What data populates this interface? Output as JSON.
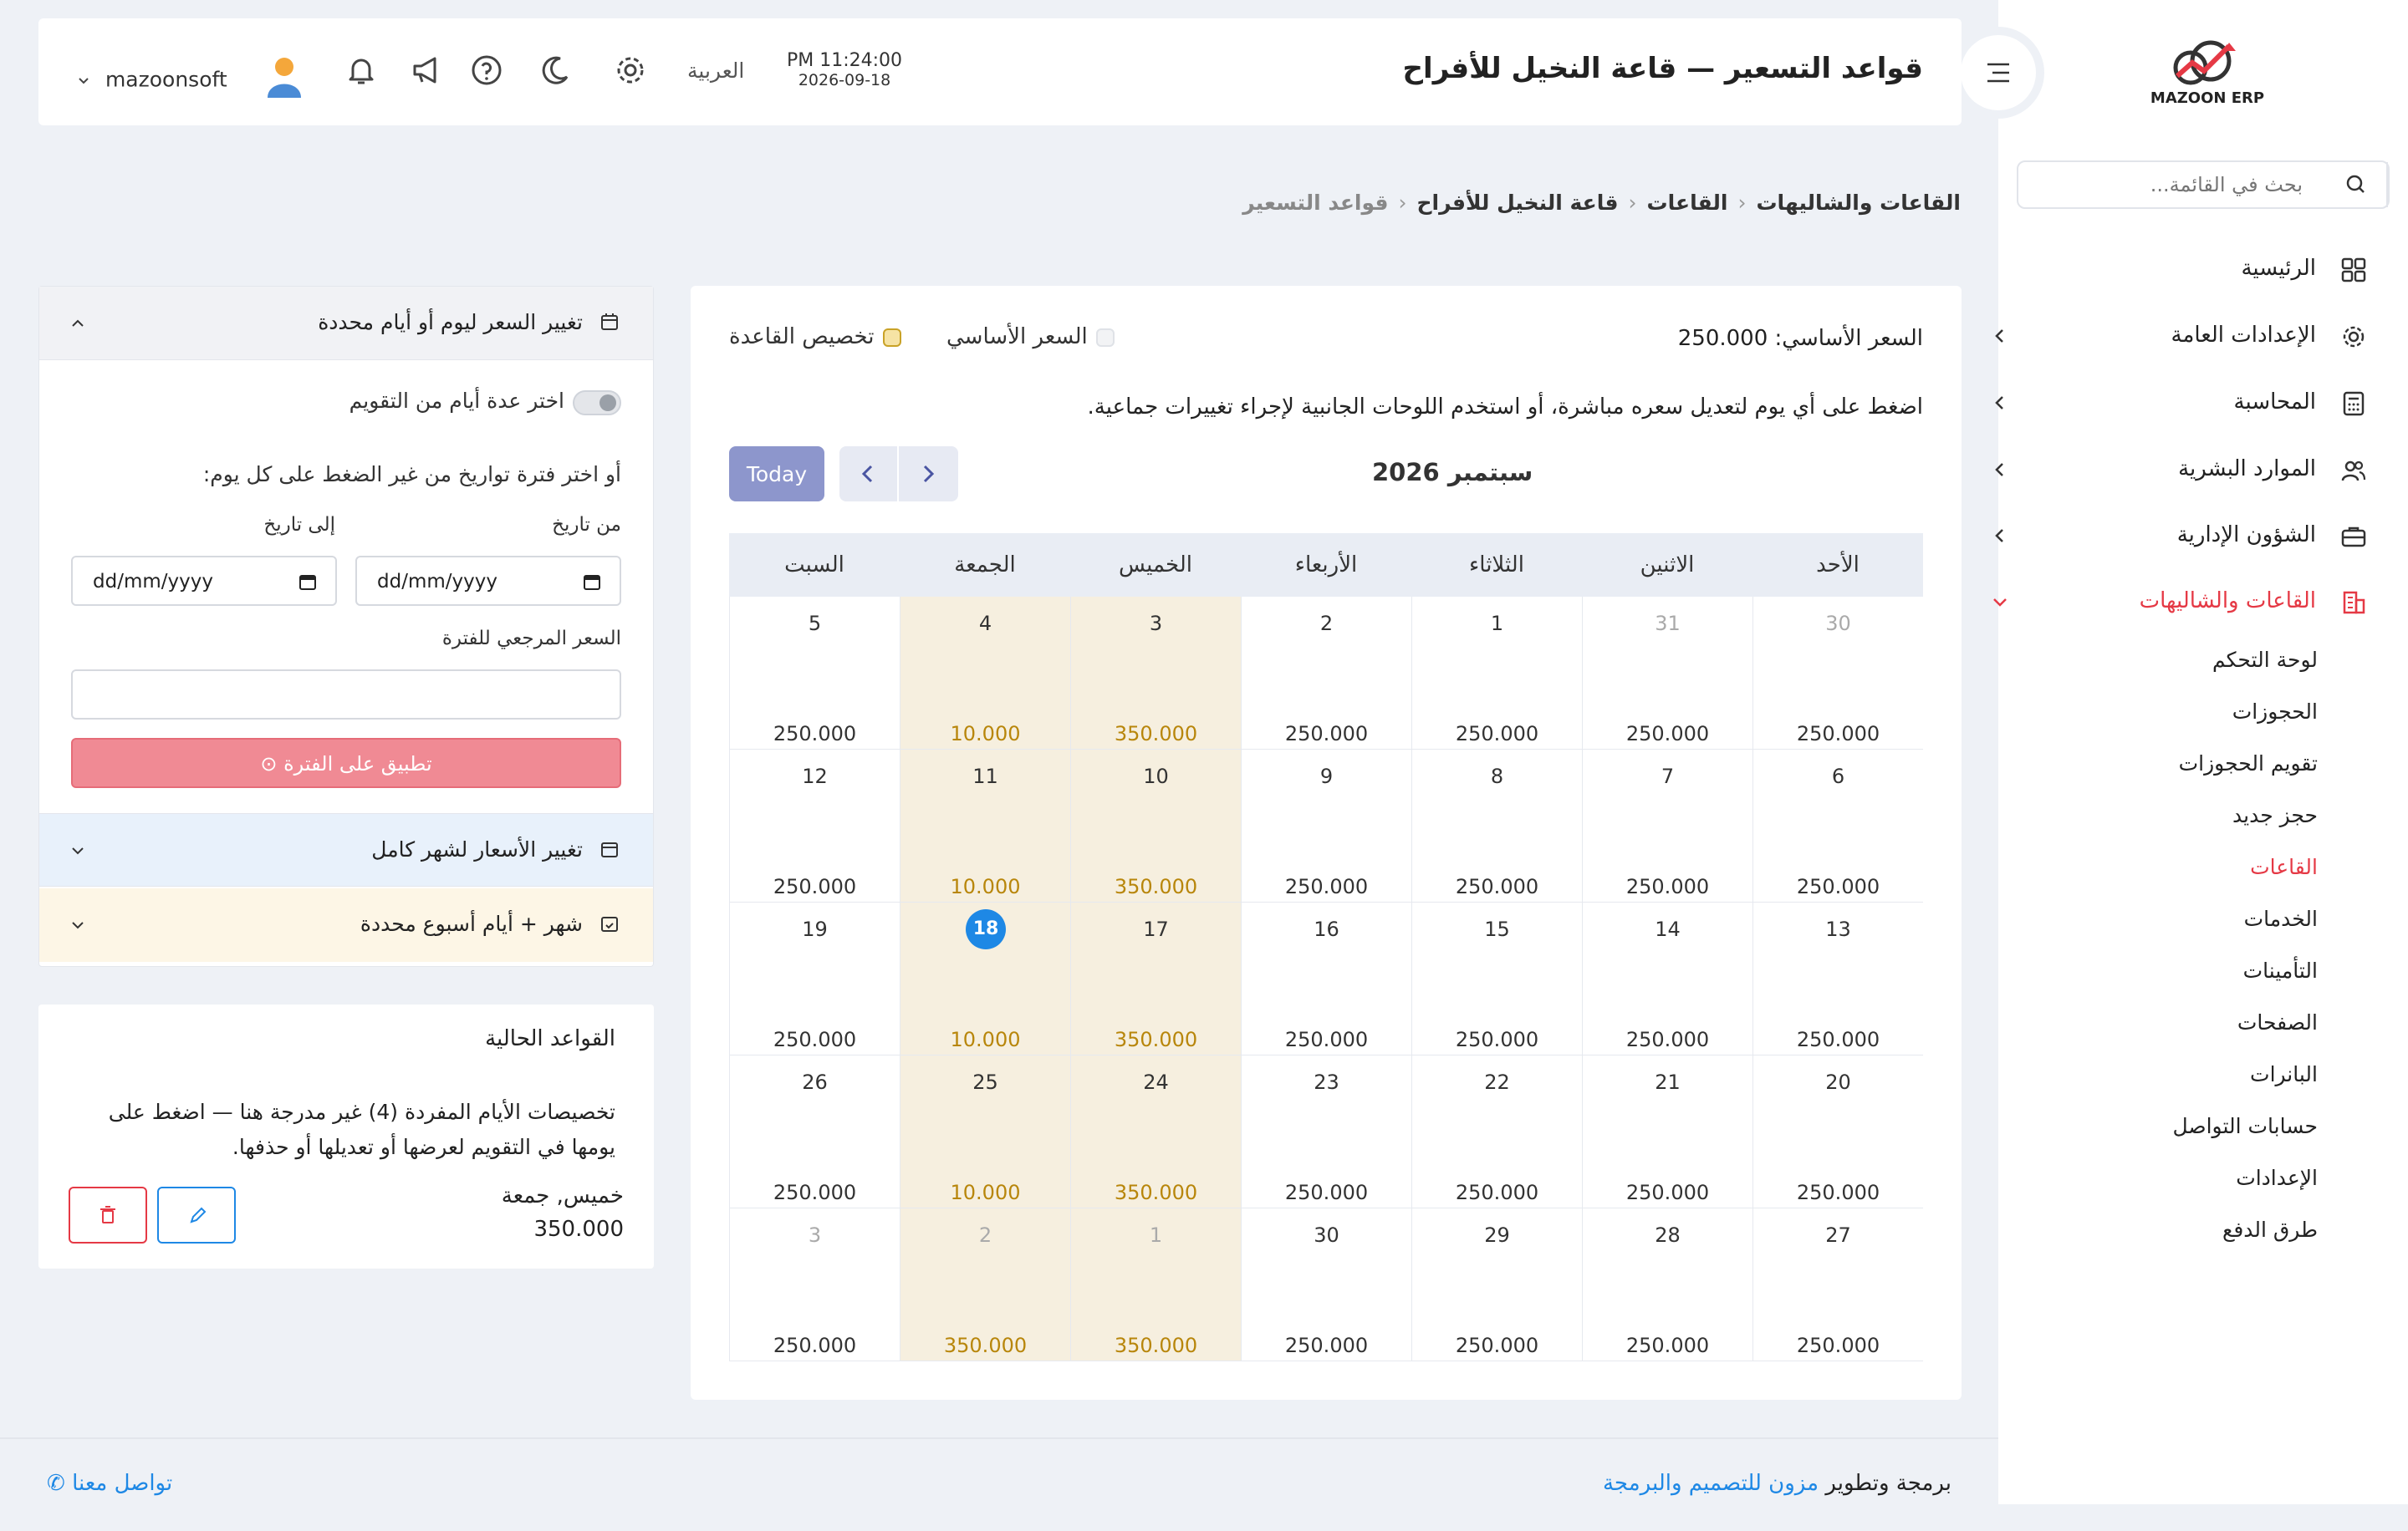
{
  "header": {
    "title": "قواعد التسعير — قاعة النخيل للأفراح",
    "time": "PM 11:24:00",
    "date": "2026-09-18",
    "language": "العربية",
    "username": "mazoonsoft"
  },
  "sidebar": {
    "logo_text": "MAZOON ERP",
    "search_placeholder": "بحث في القائمة...",
    "items": [
      {
        "label": "الرئيسية",
        "icon": "grid-icon"
      },
      {
        "label": "الإعدادات العامة",
        "icon": "gear-icon"
      },
      {
        "label": "المحاسبة",
        "icon": "calculator-icon"
      },
      {
        "label": "الموارد البشرية",
        "icon": "users-icon"
      },
      {
        "label": "الشؤون الإدارية",
        "icon": "briefcase-icon"
      },
      {
        "label": "القاعات والشاليهات",
        "icon": "building-icon"
      }
    ],
    "subitems": [
      "لوحة التحكم",
      "الحجوزات",
      "تقويم الحجوزات",
      "حجز جديد",
      "القاعات",
      "الخدمات",
      "التأمينات",
      "الصفحات",
      "البانرات",
      "حسابات التواصل",
      "الإعدادات",
      "طرق الدفع"
    ],
    "active_color": "#e53945"
  },
  "breadcrumb": [
    "القاعات والشاليهات",
    "القاعات",
    "قاعة النخيل للأفراح",
    "قواعد التسعير"
  ],
  "main": {
    "base_price_text": "السعر الأساسي: 250.000",
    "legend_base": "السعر الأساسي",
    "legend_custom": "تخصيص القاعدة",
    "hint": "اضغط على أي يوم لتعديل سعره مباشرة، أو استخدم اللوحات الجانبية لإجراء تغييرات جماعية.",
    "month_title": "سبتمبر 2026",
    "today_label": "Today"
  },
  "calendar": {
    "weekdays": [
      "الأحد",
      "الاثنين",
      "الثلاثاء",
      "الأربعاء",
      "الخميس",
      "الجمعة",
      "السبت"
    ],
    "highlight_color": "#f6efdf",
    "weeks": [
      [
        {
          "d": "30",
          "p": "250.000",
          "m": true
        },
        {
          "d": "31",
          "p": "250.000",
          "m": true
        },
        {
          "d": "1",
          "p": "250.000"
        },
        {
          "d": "2",
          "p": "250.000"
        },
        {
          "d": "3",
          "p": "350.000",
          "g": true
        },
        {
          "d": "4",
          "p": "10.000",
          "g": true
        },
        {
          "d": "5",
          "p": "250.000"
        }
      ],
      [
        {
          "d": "6",
          "p": "250.000"
        },
        {
          "d": "7",
          "p": "250.000"
        },
        {
          "d": "8",
          "p": "250.000"
        },
        {
          "d": "9",
          "p": "250.000"
        },
        {
          "d": "10",
          "p": "350.000",
          "g": true
        },
        {
          "d": "11",
          "p": "10.000",
          "g": true
        },
        {
          "d": "12",
          "p": "250.000"
        }
      ],
      [
        {
          "d": "13",
          "p": "250.000"
        },
        {
          "d": "14",
          "p": "250.000"
        },
        {
          "d": "15",
          "p": "250.000"
        },
        {
          "d": "16",
          "p": "250.000"
        },
        {
          "d": "17",
          "p": "350.000",
          "g": true
        },
        {
          "d": "18",
          "p": "10.000",
          "g": true,
          "t": true
        },
        {
          "d": "19",
          "p": "250.000"
        }
      ],
      [
        {
          "d": "20",
          "p": "250.000"
        },
        {
          "d": "21",
          "p": "250.000"
        },
        {
          "d": "22",
          "p": "250.000"
        },
        {
          "d": "23",
          "p": "250.000"
        },
        {
          "d": "24",
          "p": "350.000",
          "g": true
        },
        {
          "d": "25",
          "p": "10.000",
          "g": true
        },
        {
          "d": "26",
          "p": "250.000"
        }
      ],
      [
        {
          "d": "27",
          "p": "250.000"
        },
        {
          "d": "28",
          "p": "250.000"
        },
        {
          "d": "29",
          "p": "250.000"
        },
        {
          "d": "30",
          "p": "250.000"
        },
        {
          "d": "1",
          "p": "350.000",
          "g": true,
          "m": true
        },
        {
          "d": "2",
          "p": "350.000",
          "g": true,
          "m": true
        },
        {
          "d": "3",
          "p": "250.000",
          "m": true
        }
      ]
    ]
  },
  "panel": {
    "section1_title": "تغيير السعر ليوم أو أيام محددة",
    "toggle_label": "اختر عدة أيام من التقويم",
    "or_label": "أو اختر فترة تواريخ من غير الضغط على كل يوم:",
    "from_label": "من تاريخ",
    "to_label": "إلى تاريخ",
    "date_placeholder": "dd/mm/yyyy",
    "ref_price_label": "السعر المرجعي للفترة",
    "apply_label": "تطبيق على الفترة",
    "section2_title": "تغيير الأسعار لشهر كامل",
    "section3_title": "شهر + أيام أسبوع محددة"
  },
  "rules": {
    "title": "القواعد الحالية",
    "note": "تخصيصات الأيام المفردة (4) غير مدرجة هنا — اضغط على يومها في التقويم لعرضها أو تعديلها أو حذفها.",
    "days": "خميس, جمعة",
    "price": "350.000"
  },
  "footer": {
    "credit_prefix": "برمجة وتطوير",
    "credit_link": "مزون للتصميم والبرمجة",
    "contact": "تواصل معنا"
  }
}
